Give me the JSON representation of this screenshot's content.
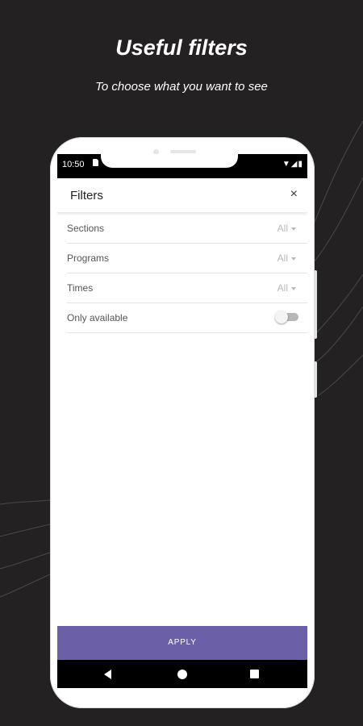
{
  "promo": {
    "headline": "Useful filters",
    "subline": "To choose what you want to see"
  },
  "statusbar": {
    "time": "10:50",
    "icons": "▼◢▮"
  },
  "filters": {
    "title": "Filters",
    "close_icon": "×",
    "rows": [
      {
        "label": "Sections",
        "value": "All"
      },
      {
        "label": "Programs",
        "value": "All"
      },
      {
        "label": "Times",
        "value": "All"
      }
    ],
    "only_available": {
      "label": "Only available",
      "enabled": false
    },
    "apply_label": "APPLY"
  },
  "colors": {
    "background": "#242122",
    "accent": "#6b5fa8"
  }
}
